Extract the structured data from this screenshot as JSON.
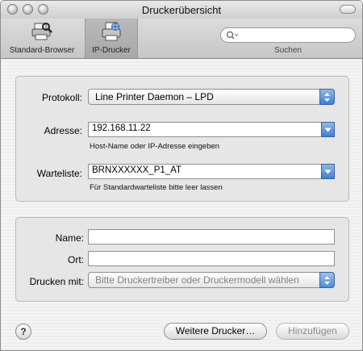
{
  "window": {
    "title": "Druckerübersicht"
  },
  "toolbar": {
    "default_browser_label": "Standard-Browser",
    "ip_printer_label": "IP-Drucker",
    "search_label": "Suchen",
    "search_placeholder": ""
  },
  "connection": {
    "protocol_label": "Protokoll:",
    "protocol_value": "Line Printer Daemon – LPD",
    "address_label": "Adresse:",
    "address_value": "192.168.11.22",
    "address_hint": "Host-Name oder IP-Adresse eingeben",
    "queue_label": "Warteliste:",
    "queue_value": "BRNXXXXXX_P1_AT",
    "queue_hint": "Für Standardwarteliste bitte leer lassen"
  },
  "printer": {
    "name_label": "Name:",
    "name_value": "",
    "location_label": "Ort:",
    "location_value": "",
    "print_with_label": "Drucken mit:",
    "print_with_value": "Bitte Druckertreiber oder Druckermodell wählen"
  },
  "footer": {
    "help_symbol": "?",
    "more_printers_label": "Weitere Drucker…",
    "add_label": "Hinzufügen"
  },
  "colors": {
    "accent_blue": "#3f7fd6"
  }
}
